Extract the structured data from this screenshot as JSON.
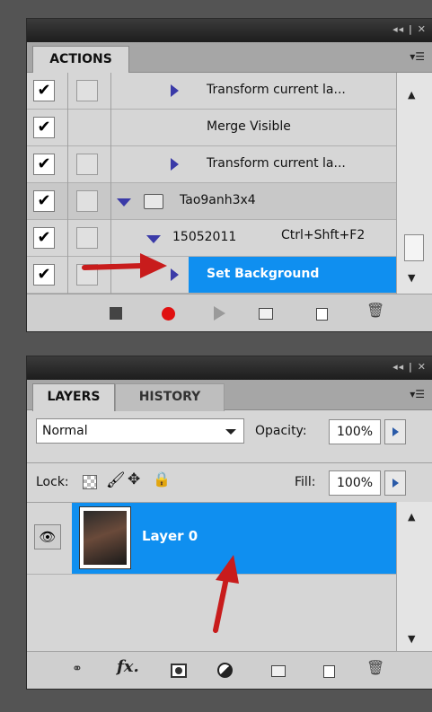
{
  "actions_panel": {
    "tab": "ACTIONS",
    "rows": [
      {
        "label": "Transform current la..."
      },
      {
        "label": "Merge Visible"
      },
      {
        "label": "Transform current la..."
      },
      {
        "label": "Tao9anh3x4"
      },
      {
        "label": "15052011",
        "shortcut": "Ctrl+Shft+F2"
      },
      {
        "label": "Set Background"
      }
    ],
    "footer_icons": [
      "stop-icon",
      "record-icon",
      "play-icon",
      "new-set-icon",
      "new-action-icon",
      "delete-icon"
    ]
  },
  "layers_panel": {
    "tabs": [
      "LAYERS",
      "HISTORY"
    ],
    "blend_mode": "Normal",
    "opacity_label": "Opacity:",
    "opacity_value": "100%",
    "lock_label": "Lock:",
    "fill_label": "Fill:",
    "fill_value": "100%",
    "layers": [
      {
        "name": "Layer 0"
      }
    ],
    "footer_icons": [
      "link-icon",
      "fx-icon",
      "mask-icon",
      "adjustment-icon",
      "group-icon",
      "new-layer-icon",
      "delete-icon"
    ]
  },
  "colors": {
    "selection": "#0f8ff0",
    "annotation_arrow": "#c81c1c",
    "panel_bg": "#d6d6d6",
    "page_bg": "#545454"
  }
}
